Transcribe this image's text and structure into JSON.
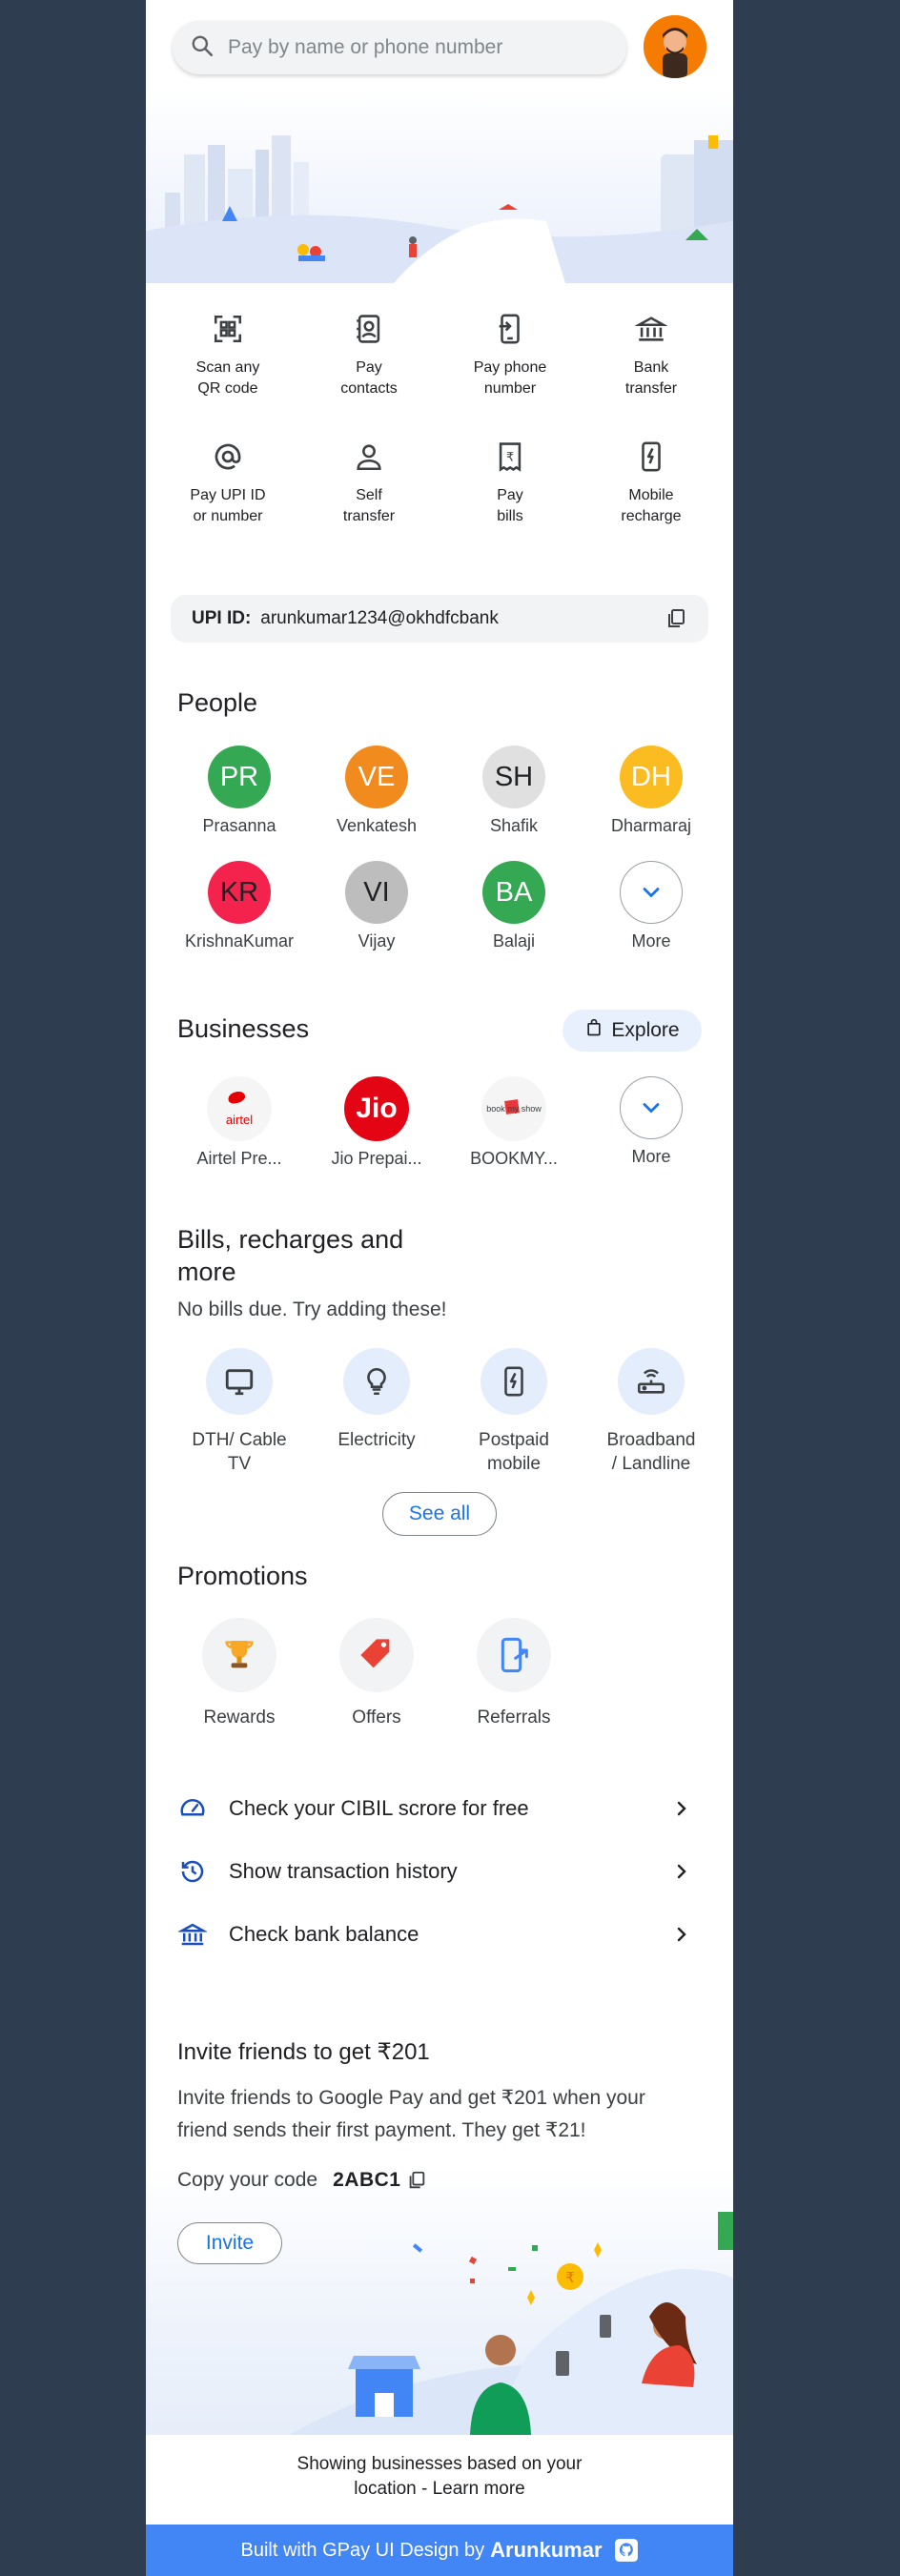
{
  "search": {
    "placeholder": "Pay by name or phone number"
  },
  "quick_actions": [
    {
      "label": "Scan any\nQR code",
      "icon": "qr-scan-icon"
    },
    {
      "label": "Pay\ncontacts",
      "icon": "contacts-icon"
    },
    {
      "label": "Pay phone\nnumber",
      "icon": "phone-pay-icon"
    },
    {
      "label": "Bank\ntransfer",
      "icon": "bank-icon"
    },
    {
      "label": "Pay UPI ID\nor number",
      "icon": "at-icon"
    },
    {
      "label": "Self\ntransfer",
      "icon": "person-icon"
    },
    {
      "label": "Pay\nbills",
      "icon": "bill-icon"
    },
    {
      "label": "Mobile\nrecharge",
      "icon": "mobile-recharge-icon"
    }
  ],
  "upi": {
    "label": "UPI ID:",
    "value": "arunkumar1234@okhdfcbank"
  },
  "people": {
    "title": "People",
    "items": [
      {
        "initials": "PR",
        "name": "Prasanna",
        "color": "#34a853"
      },
      {
        "initials": "VE",
        "name": "Venkatesh",
        "color": "#f28b1e"
      },
      {
        "initials": "SH",
        "name": "Shafik",
        "color": "#e0e0e0"
      },
      {
        "initials": "DH",
        "name": "Dharmaraj",
        "color": "#fbbc22"
      },
      {
        "initials": "KR",
        "name": "KrishnaKumar",
        "color": "#f4234d"
      },
      {
        "initials": "VI",
        "name": "Vijay",
        "color": "#bdbdbd"
      },
      {
        "initials": "BA",
        "name": "Balaji",
        "color": "#34a853"
      }
    ],
    "more_label": "More"
  },
  "businesses": {
    "title": "Businesses",
    "explore_label": "Explore",
    "items": [
      {
        "name": "Airtel Pre...",
        "logo_text": "airtel"
      },
      {
        "name": "Jio Prepai...",
        "logo_text": "Jio"
      },
      {
        "name": "BOOKMY...",
        "logo_text": "book my show"
      }
    ],
    "more_label": "More"
  },
  "bills": {
    "title": "Bills, recharges and\nmore",
    "subtitle": "No bills due. Try adding these!",
    "items": [
      {
        "label": "DTH/ Cable\nTV",
        "icon": "tv-icon"
      },
      {
        "label": "Electricity",
        "icon": "bulb-icon"
      },
      {
        "label": "Postpaid\nmobile",
        "icon": "postpaid-mobile-icon"
      },
      {
        "label": "Broadband\n/ Landline",
        "icon": "router-icon"
      }
    ],
    "see_all_label": "See all"
  },
  "promotions": {
    "title": "Promotions",
    "items": [
      {
        "label": "Rewards",
        "icon": "trophy-icon"
      },
      {
        "label": "Offers",
        "icon": "tag-icon"
      },
      {
        "label": "Referrals",
        "icon": "referral-icon"
      }
    ]
  },
  "links": [
    {
      "label": "Check your CIBIL scrore for free",
      "icon": "speedometer-icon"
    },
    {
      "label": "Show transaction history",
      "icon": "history-icon"
    },
    {
      "label": "Check bank balance",
      "icon": "bank-icon"
    }
  ],
  "invite": {
    "title": "Invite friends to get ₹201",
    "description": "Invite friends to Google Pay and get ₹201 when your friend sends their first payment. They get ₹21!",
    "copy_label": "Copy your code",
    "code": "2ABC1",
    "button_label": "Invite"
  },
  "footer": {
    "note": "Showing businesses based on your location - Learn more",
    "built_prefix": "Built with GPay UI Design by",
    "author": "Arunkumar"
  },
  "colors": {
    "accent": "#1a73e8",
    "bottom_bar": "#4285f4",
    "page_bg": "#2e3d4f"
  }
}
